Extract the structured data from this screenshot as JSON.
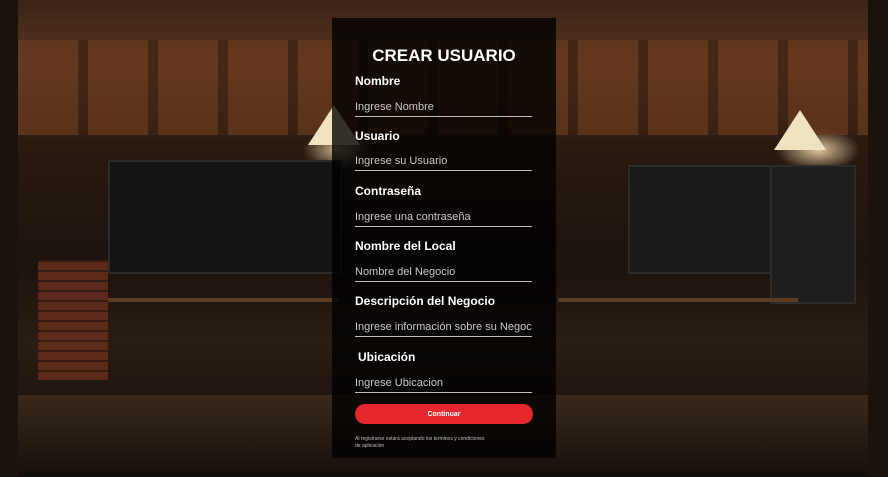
{
  "form": {
    "title": "CREAR USUARIO",
    "fields": [
      {
        "label": "Nombre",
        "placeholder": "Ingrese Nombre"
      },
      {
        "label": "Usuario",
        "placeholder": "Ingrese su Usuario"
      },
      {
        "label": "Contraseña",
        "placeholder": "Ingrese una contraseña"
      },
      {
        "label": "Nombre del Local",
        "placeholder": "Nombre del Negocio"
      },
      {
        "label": "Descripción del Negocio",
        "placeholder": "Ingrese información sobre su Negocio"
      },
      {
        "label": "Ubicación",
        "placeholder": "Ingrese Ubicacion"
      }
    ],
    "submit_label": "Continuar",
    "terms_text": "Al registrarse estará aceptando los terminos y condiciones de aplicación"
  },
  "colors": {
    "button": "#e5262c",
    "panel": "rgba(0,0,0,0.78)"
  }
}
